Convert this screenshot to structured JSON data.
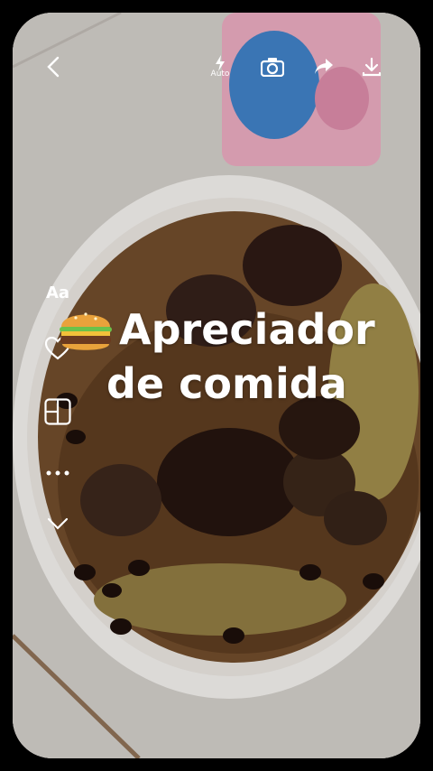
{
  "topbar": {
    "back_icon": "chevron-left-icon",
    "flash_label": "Auto",
    "flash_icon": "flash-icon",
    "camera_icon": "camera-icon",
    "share_icon": "share-icon",
    "download_icon": "download-icon"
  },
  "sidebar": {
    "text_tool_label": "Aa",
    "items": [
      "text-tool-icon",
      "heart-icon",
      "layout-icon",
      "more-icon",
      "expand-icon"
    ]
  },
  "caption": {
    "emoji": "hamburger-icon",
    "line1": "Apreciador",
    "line2": "de comida"
  },
  "colors": {
    "icon": "#ffffff",
    "broth": "#6b4a2a",
    "bowl": "#f2f0ee",
    "table": "#d8d4cf"
  }
}
